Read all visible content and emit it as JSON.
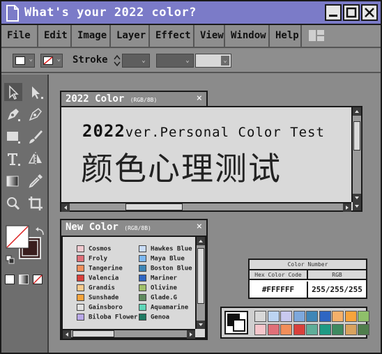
{
  "window": {
    "title": "What's your 2022 color?"
  },
  "menu": [
    "File",
    "Edit",
    "Image",
    "Layer",
    "Effect",
    "View",
    "Window",
    "Help"
  ],
  "toolbar": {
    "stroke_label": "Stroke"
  },
  "panel_main": {
    "title": "2022 Color",
    "subtitle": "(RGB/8B)",
    "headline_bold": "2022",
    "headline_rest": "ver.Personal Color Test",
    "headline_cn": "颜色心理测试"
  },
  "panel_new": {
    "title": "New Color",
    "subtitle": "(RGB/8B)",
    "left_colors": [
      {
        "name": "Cosmos",
        "hex": "#f2c9cf"
      },
      {
        "name": "Froly",
        "hex": "#e06f78"
      },
      {
        "name": "Tangerine",
        "hex": "#f28e5a"
      },
      {
        "name": "Valencia",
        "hex": "#d9403b"
      },
      {
        "name": "Grandis",
        "hex": "#f9c98a"
      },
      {
        "name": "Sunshade",
        "hex": "#f7a43c"
      },
      {
        "name": "Gainsboro",
        "hex": "#e1e1e1"
      },
      {
        "name": "Biloba Flower",
        "hex": "#b9a8e8"
      }
    ],
    "right_colors": [
      {
        "name": "Hawkes Blue",
        "hex": "#c9dcf8"
      },
      {
        "name": "Maya Blue",
        "hex": "#7cb8f2"
      },
      {
        "name": "Boston Blue",
        "hex": "#3f86b7"
      },
      {
        "name": "Mariner",
        "hex": "#2f66c2"
      },
      {
        "name": "Olivine",
        "hex": "#9fbf6a"
      },
      {
        "name": "Glade.G",
        "hex": "#5f8a5e"
      },
      {
        "name": "Aquamarine",
        "hex": "#5fd6b8"
      },
      {
        "name": "Genoa",
        "hex": "#1f7a63"
      }
    ]
  },
  "color_number": {
    "title": "Color Number",
    "hex_label": "Hex Color Code",
    "rgb_label": "RGB",
    "hex_value": "#FFFFFF",
    "rgb_value": "255/255/255"
  },
  "palette": {
    "row1": [
      "#d8d8d8",
      "#bcd4f2",
      "#c9c9ef",
      "#7ea8dc",
      "#3f86b7",
      "#2f66c2",
      "#f4b06a",
      "#f7a43c",
      "#8fbf6a"
    ],
    "row2": [
      "#f5c6cb",
      "#e06f78",
      "#f28e5a",
      "#d9403b",
      "#5fae99",
      "#1f9a84",
      "#3e8a60",
      "#d9a35f",
      "#4f7d4c"
    ]
  },
  "colors": {
    "title_bar": "#7b7bc8",
    "panel_body": "#d9d9d9"
  }
}
